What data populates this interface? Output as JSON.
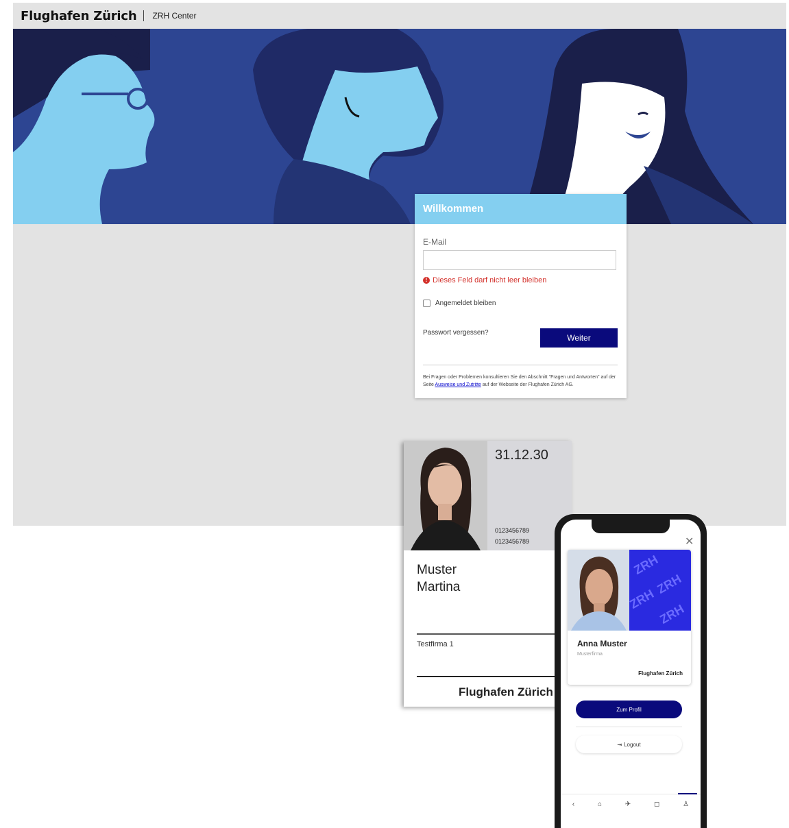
{
  "header": {
    "brand": "Flughafen Zürich",
    "subtitle": "ZRH Center"
  },
  "login": {
    "title": "Willkommen",
    "email_label": "E-Mail",
    "email_value": "",
    "error": "Dieses Feld darf nicht leer bleiben",
    "remember_label": "Angemeldet bleiben",
    "forgot_label": "Passwort vergessen?",
    "submit_label": "Weiter",
    "info_prefix": "Bei Fragen oder Problemen konsultieren Sie den Abschnitt \"Fragen und Antworten\" auf der Seite ",
    "info_link": "Ausweise und Zutritte",
    "info_suffix": " auf der Webseite der Flughafen Zürich AG."
  },
  "badge": {
    "date": "31.12.30",
    "number1": "0123456789",
    "number2": "0123456789",
    "last_name": "Muster",
    "first_name": "Martina",
    "company": "Testfirma 1",
    "brand": "Flughafen Zürich"
  },
  "phone": {
    "name": "Anna Muster",
    "company": "Musterfirma",
    "brand": "Flughafen Zürich",
    "pattern_text": "ZRH",
    "profile_button": "Zum Profil",
    "logout_button": "Logout",
    "icons": [
      "close-icon",
      "back-icon",
      "home-icon",
      "plane-icon",
      "bag-icon",
      "user-icon"
    ]
  },
  "colors": {
    "hero": "#2d4592",
    "accent": "#84cff0",
    "primary": "#0a0a7c",
    "error": "#d3302a"
  }
}
